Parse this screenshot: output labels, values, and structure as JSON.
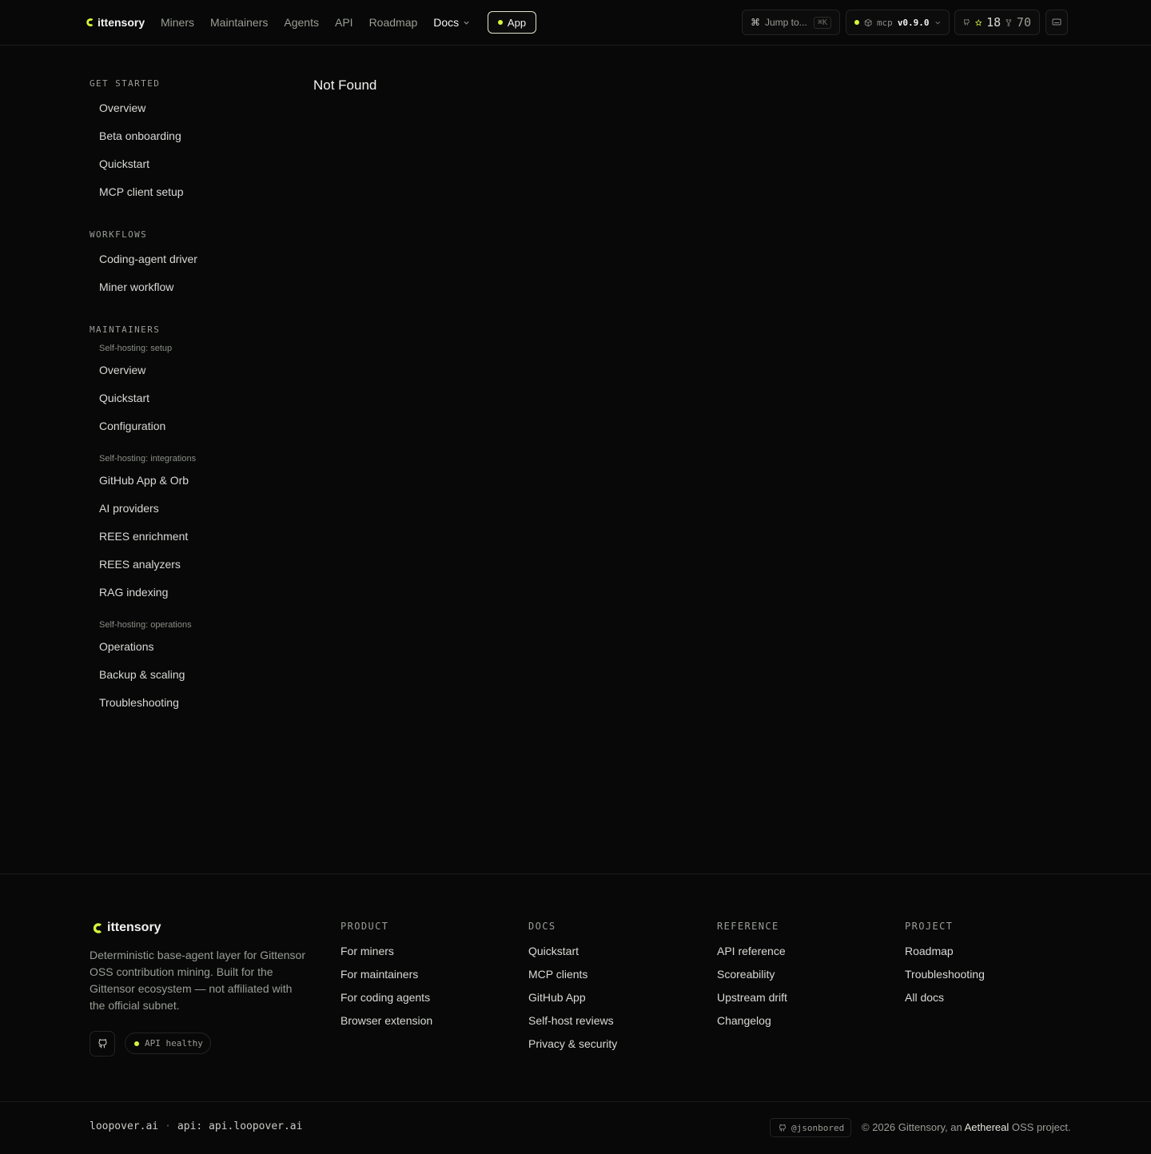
{
  "brand": {
    "name": "ittensory",
    "accent": "#d7f53c"
  },
  "nav": {
    "items": [
      "Miners",
      "Maintainers",
      "Agents",
      "API",
      "Roadmap"
    ],
    "active": "Docs",
    "app_label": "App"
  },
  "header": {
    "jump_label": "Jump to...",
    "jump_shortcut": "⌘K",
    "mcp_key": "mcp",
    "mcp_version": "v0.9.0",
    "stars": "18",
    "forks": "70"
  },
  "sidebar": {
    "get_started": {
      "title": "GET STARTED",
      "items": [
        "Overview",
        "Beta onboarding",
        "Quickstart",
        "MCP client setup"
      ]
    },
    "workflows": {
      "title": "WORKFLOWS",
      "items": [
        "Coding-agent driver",
        "Miner workflow"
      ]
    },
    "maintainers": {
      "title": "MAINTAINERS",
      "setup": {
        "title": "Self-hosting: setup",
        "items": [
          "Overview",
          "Quickstart",
          "Configuration"
        ]
      },
      "integrations": {
        "title": "Self-hosting: integrations",
        "items": [
          "GitHub App & Orb",
          "AI providers",
          "REES enrichment",
          "REES analyzers",
          "RAG indexing"
        ]
      },
      "operations": {
        "title": "Self-hosting: operations",
        "items": [
          "Operations",
          "Backup & scaling",
          "Troubleshooting"
        ]
      }
    }
  },
  "main": {
    "title": "Not Found"
  },
  "footer": {
    "brand": "ittensory",
    "description": "Deterministic base-agent layer for Gittensor OSS contribution mining. Built for the Gittensor ecosystem — not affiliated with the official subnet.",
    "health": "API healthy",
    "columns": [
      {
        "title": "PRODUCT",
        "links": [
          "For miners",
          "For maintainers",
          "For coding agents",
          "Browser extension"
        ]
      },
      {
        "title": "DOCS",
        "links": [
          "Quickstart",
          "MCP clients",
          "GitHub App",
          "Self-host reviews",
          "Privacy & security"
        ]
      },
      {
        "title": "REFERENCE",
        "links": [
          "API reference",
          "Scoreability",
          "Upstream drift",
          "Changelog"
        ]
      },
      {
        "title": "PROJECT",
        "links": [
          "Roadmap",
          "Troubleshooting",
          "All docs"
        ]
      }
    ],
    "site": "loopover.ai",
    "separator": "·",
    "api": "api: api.loopover.ai",
    "handle": "@jsonbored",
    "copyright_prefix": "© 2026 Gittensory, an",
    "copyright_org": "Aethereal",
    "copyright_suffix": "OSS project."
  }
}
